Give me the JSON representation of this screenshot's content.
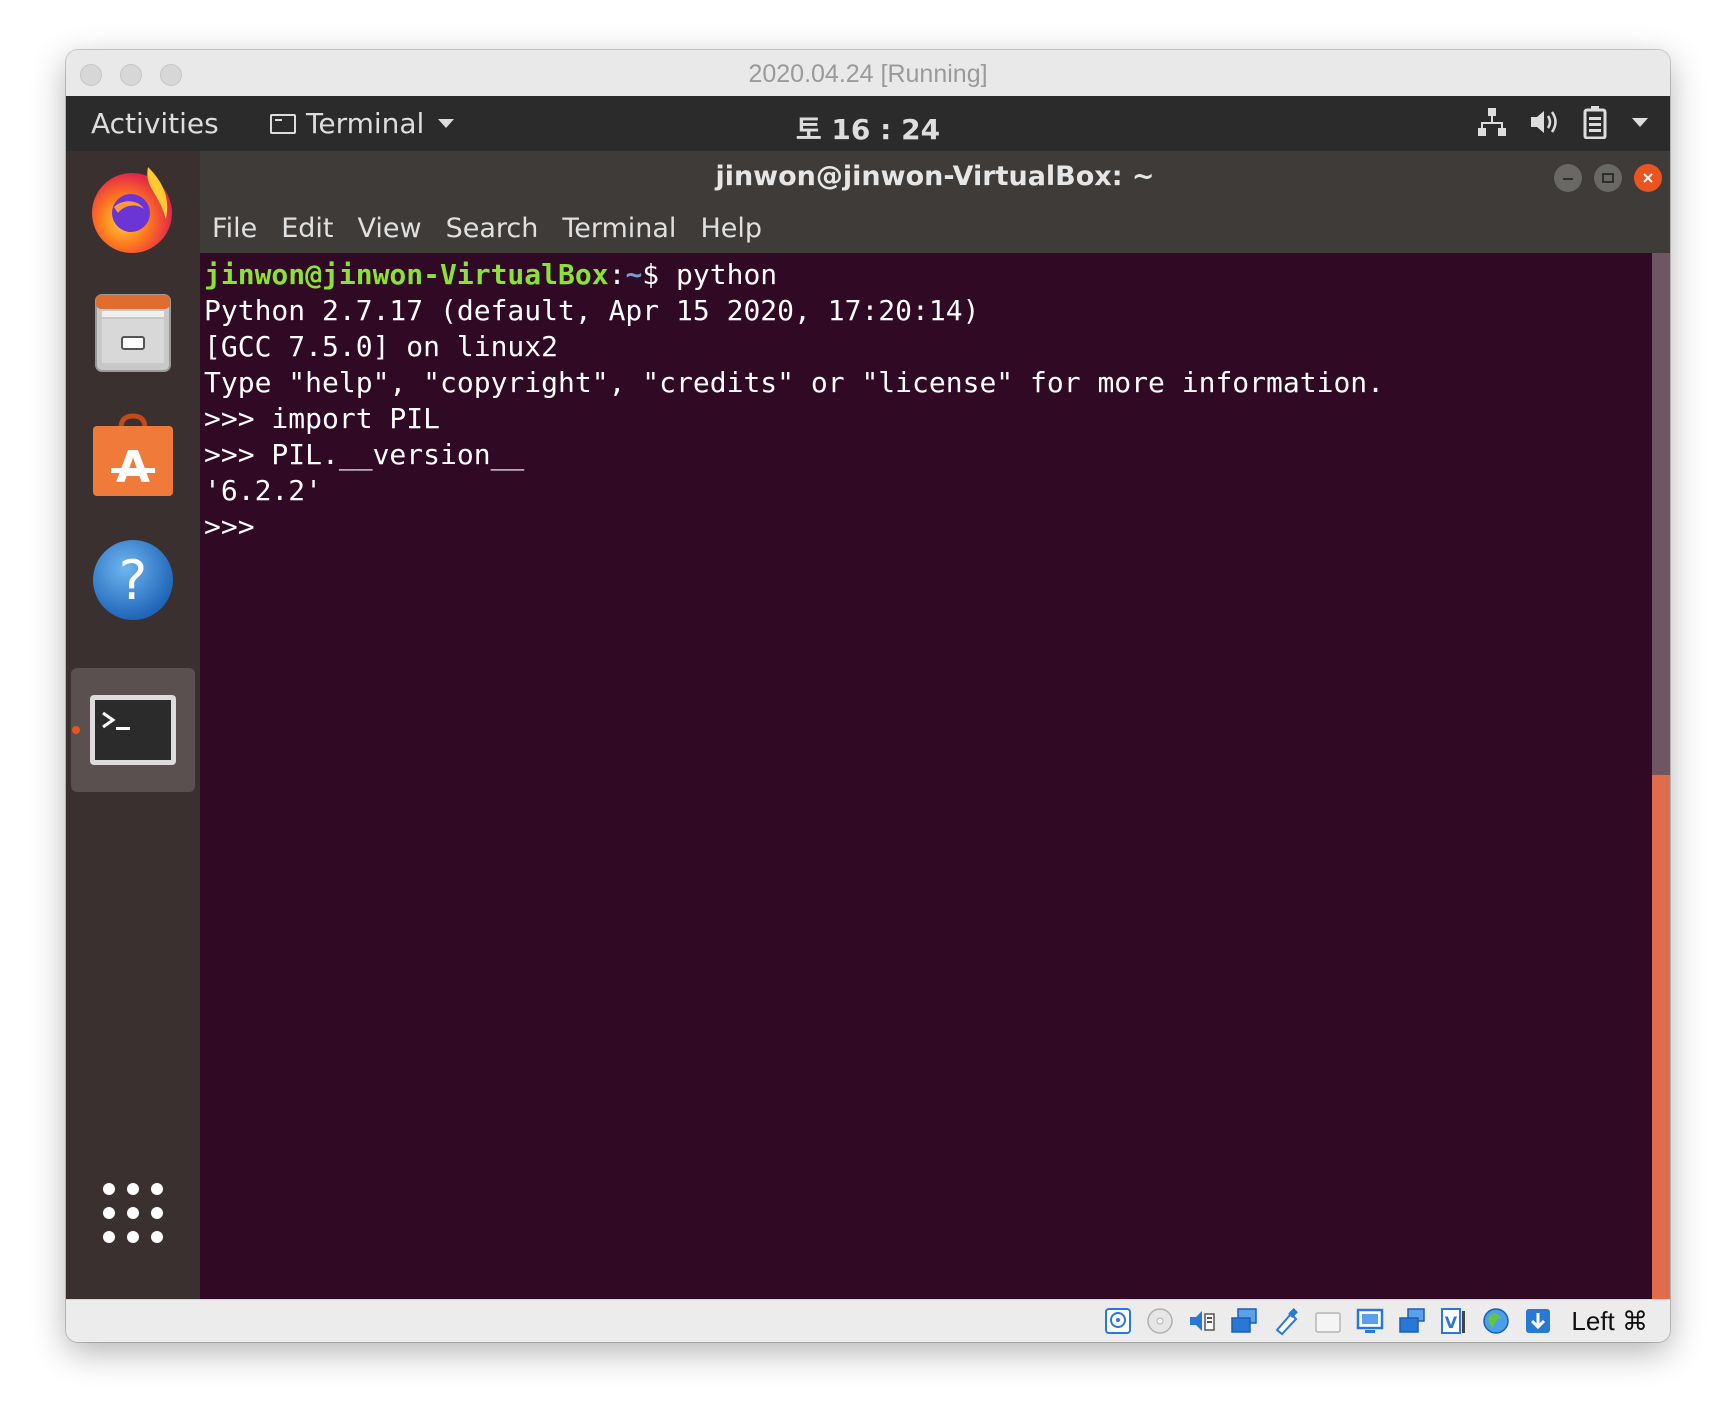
{
  "host_window": {
    "title": "2020.04.24 [Running]",
    "host_key": "Left ⌘"
  },
  "ubuntu_topbar": {
    "activities": "Activities",
    "app_name": "Terminal",
    "clock": "토 16 : 24"
  },
  "dock": {
    "items": [
      "firefox-icon",
      "files-icon",
      "software-center-icon",
      "help-icon",
      "terminal-icon",
      "show-apps-icon"
    ]
  },
  "terminal": {
    "title": "jinwon@jinwon-VirtualBox: ~",
    "menu": [
      "File",
      "Edit",
      "View",
      "Search",
      "Terminal",
      "Help"
    ],
    "prompt_user": "jinwon@jinwon-VirtualBox",
    "prompt_path": "~",
    "prompt_suffix": "$ python",
    "lines": [
      "Python 2.7.17 (default, Apr 15 2020, 17:20:14)",
      "[GCC 7.5.0] on linux2",
      "Type \"help\", \"copyright\", \"credits\" or \"license\" for more information.",
      ">>> import PIL",
      ">>> PIL.__version__",
      "'6.2.2'",
      ">>> "
    ],
    "colors": {
      "background": "#300a24",
      "prompt_user": "#8ae234",
      "prompt_path": "#729fcf",
      "accent": "#e95420"
    }
  }
}
